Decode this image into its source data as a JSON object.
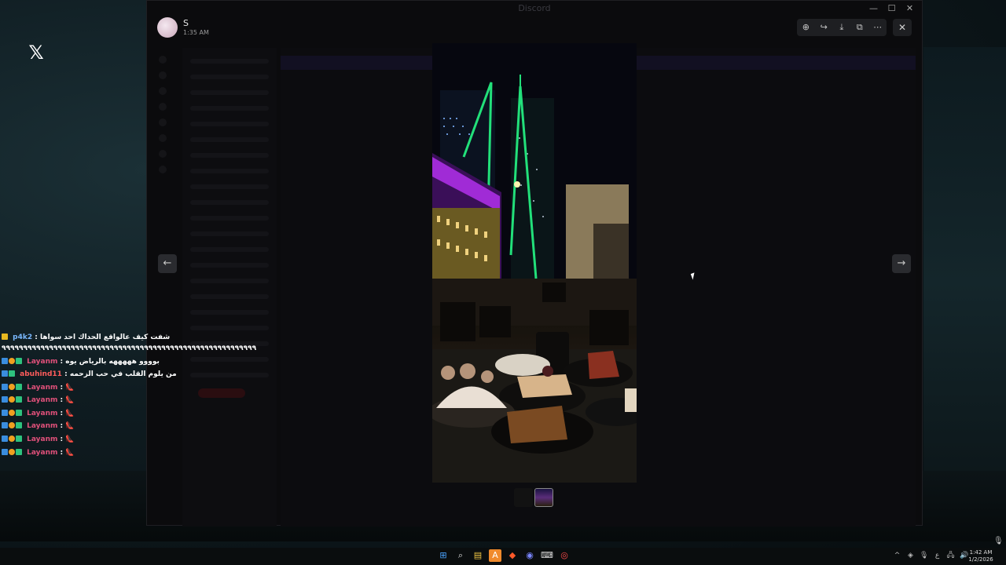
{
  "stream": {
    "x_logo": "𝕏"
  },
  "window": {
    "title": "Discord",
    "controls": {
      "minimize": "—",
      "maximize": "☐",
      "close": "✕"
    }
  },
  "viewer": {
    "author_initial": "S",
    "time": "1:35 AM",
    "toolbar": {
      "zoom_icon": "⊕",
      "forward_icon": "↪",
      "download_icon": "⤓",
      "open_external_icon": "⧉",
      "more_icon": "⋯"
    },
    "close_icon": "✕",
    "prev_icon": "←",
    "next_icon": "→"
  },
  "chat": [
    {
      "user": "p4k2",
      "text": "شفت كيف عالواقع الحداك احد سواها",
      "style": "blue"
    },
    {
      "user": "",
      "text": "٩٩٩٩٩٩٩٩٩٩٩٩٩٩٩٩٩٩٩٩٩٩٩٩٩٩٩٩٩٩٩٩٩٩٩٩٩٩٩٩٩٩٩٩٩٩٩٩٩٩٩٩٩٩٩٩٩٩٩",
      "style": "none"
    },
    {
      "user": "Layanm",
      "text": "بوووو هههههه بالرياض يوه",
      "style": "pink"
    },
    {
      "user": "abuhind11",
      "text": "من يلوم القلب في حب الزحمه",
      "style": "red"
    },
    {
      "user": "Layanm",
      "text": "👠",
      "style": "pink"
    },
    {
      "user": "Layanm",
      "text": "👠",
      "style": "pink"
    },
    {
      "user": "Layanm",
      "text": "👠",
      "style": "pink"
    },
    {
      "user": "Layanm",
      "text": "👠",
      "style": "pink"
    },
    {
      "user": "Layanm",
      "text": "👠",
      "style": "pink"
    },
    {
      "user": "Layanm",
      "text": "👠",
      "style": "pink"
    }
  ],
  "taskbar": {
    "apps": [
      "⊞",
      "⌕",
      "▤",
      "A",
      "◆",
      "◉",
      "⌨",
      "◎"
    ],
    "tray": [
      "^",
      "◈",
      "🎙",
      "ع",
      "🖧",
      "🔊"
    ],
    "time": "1:42 AM",
    "date": "1/2/2026"
  },
  "colors": {
    "accent_purple": "#a02bd6",
    "neon_green": "#22e07a",
    "username_pink": "#e0507a"
  }
}
